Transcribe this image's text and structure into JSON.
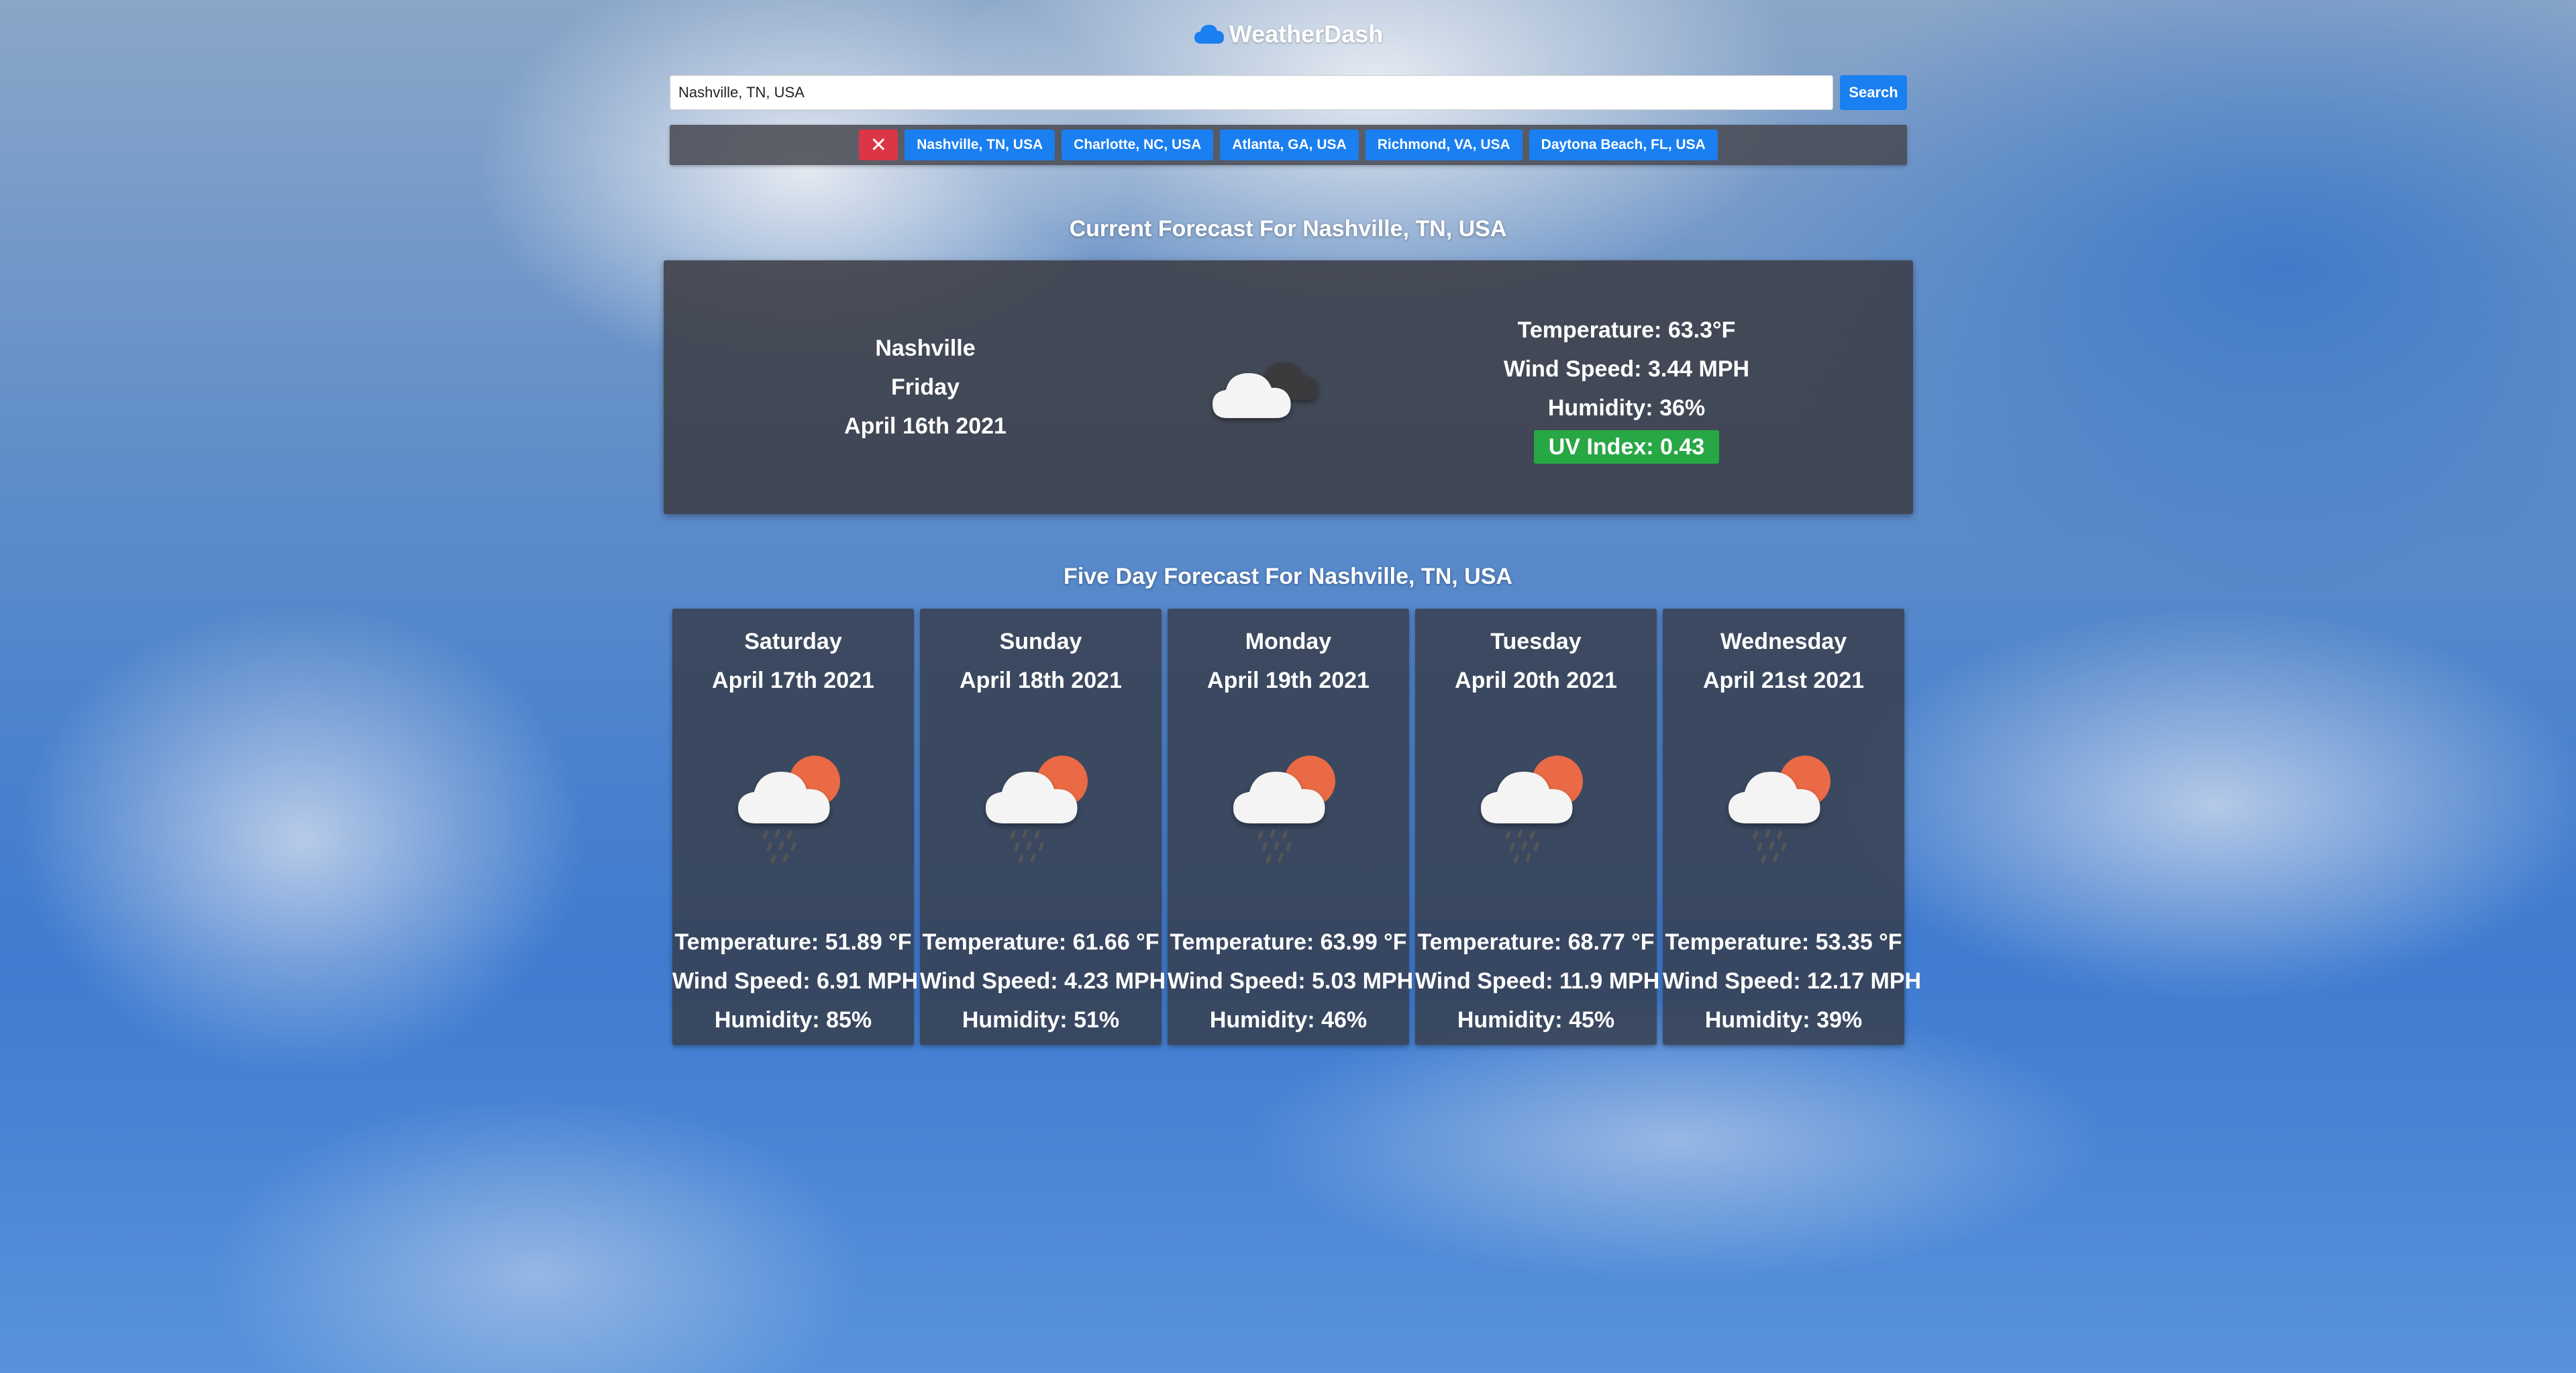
{
  "app": {
    "title": "WeatherDash",
    "logo_icon": "cloud-icon",
    "accent": "#1a7ff0"
  },
  "search": {
    "value": "Nashville, TN, USA",
    "button_label": "Search"
  },
  "history": {
    "clear_label": "✕",
    "cities": [
      "Nashville, TN, USA",
      "Charlotte, NC, USA",
      "Atlanta, GA, USA",
      "Richmond, VA, USA",
      "Daytona Beach, FL, USA"
    ]
  },
  "current": {
    "heading": "Current Forecast For Nashville, TN, USA",
    "city": "Nashville",
    "weekday": "Friday",
    "date": "April 16th 2021",
    "icon": "cloudy-icon",
    "temperature": "Temperature: 63.3°F",
    "wind": "Wind Speed: 3.44 MPH",
    "humidity": "Humidity: 36%",
    "uv": "UV Index: 0.43",
    "uv_color": "#28a745"
  },
  "forecast": {
    "heading": "Five Day Forecast For Nashville, TN, USA",
    "days": [
      {
        "weekday": "Saturday",
        "date": "April 17th 2021",
        "icon": "rain-sun-icon",
        "temperature": "Temperature: 51.89 °F",
        "wind": "Wind Speed: 6.91 MPH",
        "humidity": "Humidity: 85%"
      },
      {
        "weekday": "Sunday",
        "date": "April 18th 2021",
        "icon": "rain-sun-icon",
        "temperature": "Temperature: 61.66 °F",
        "wind": "Wind Speed: 4.23 MPH",
        "humidity": "Humidity: 51%"
      },
      {
        "weekday": "Monday",
        "date": "April 19th 2021",
        "icon": "rain-sun-icon",
        "temperature": "Temperature: 63.99 °F",
        "wind": "Wind Speed: 5.03 MPH",
        "humidity": "Humidity: 46%"
      },
      {
        "weekday": "Tuesday",
        "date": "April 20th 2021",
        "icon": "rain-sun-icon",
        "temperature": "Temperature: 68.77 °F",
        "wind": "Wind Speed: 11.9 MPH",
        "humidity": "Humidity: 45%"
      },
      {
        "weekday": "Wednesday",
        "date": "April 21st 2021",
        "icon": "rain-sun-icon",
        "temperature": "Temperature: 53.35 °F",
        "wind": "Wind Speed: 12.17 MPH",
        "humidity": "Humidity: 39%"
      }
    ]
  }
}
